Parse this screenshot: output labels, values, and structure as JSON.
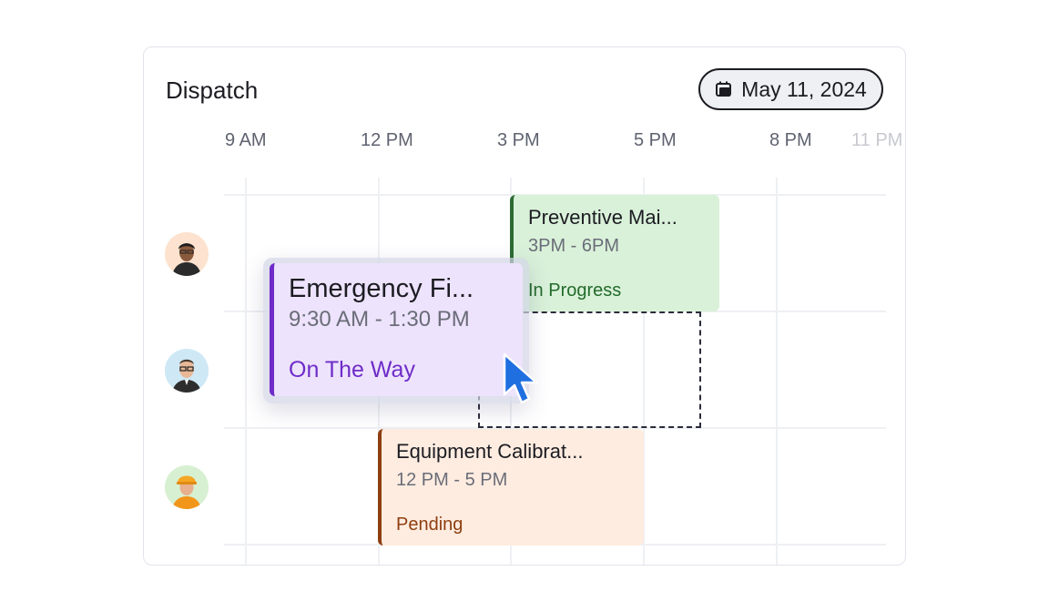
{
  "header": {
    "title": "Dispatch",
    "date": "May 11, 2024",
    "date_icon": "calendar-icon"
  },
  "timeline": {
    "hours": [
      "9 AM",
      "12 PM",
      "3 PM",
      "5 PM",
      "8 PM",
      "11 PM"
    ]
  },
  "technicians": [
    {
      "avatar": "avatar-man-glasses-dark-hair"
    },
    {
      "avatar": "avatar-man-glasses-blue"
    },
    {
      "avatar": "avatar-worker-hardhat"
    }
  ],
  "events": {
    "preventive": {
      "name": "Preventive Mai...",
      "time": "3PM - 6PM",
      "status": "In Progress",
      "color": "#d9f1d9",
      "accent": "#2d6b34"
    },
    "emergency": {
      "name": "Emergency Fi...",
      "time": "9:30 AM - 1:30 PM",
      "status": "On The Way",
      "color": "#ede3fc",
      "accent": "#6f2cc8"
    },
    "calibration": {
      "name": "Equipment Calibrat...",
      "time": "12 PM - 5 PM",
      "status": "Pending",
      "color": "#feece0",
      "accent": "#8e3e10"
    }
  },
  "cursor": "pointer-cursor-icon"
}
